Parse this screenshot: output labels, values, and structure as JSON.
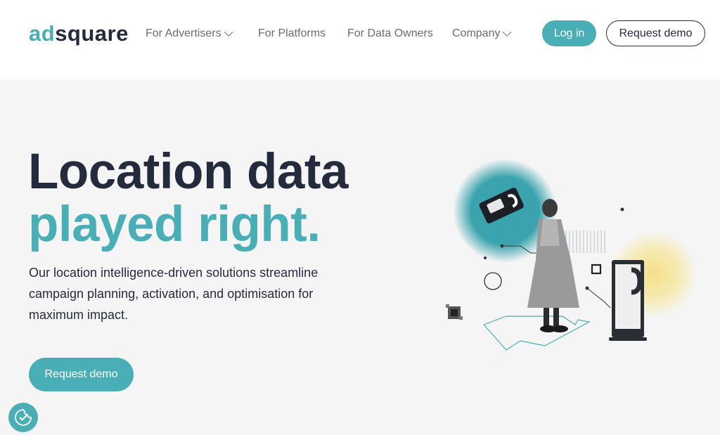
{
  "brand": {
    "logo_part1": "ad",
    "logo_part2": "square",
    "accent": "#4aaeb7",
    "dark": "#242b3d"
  },
  "nav": {
    "items": [
      {
        "label": "For Advertisers",
        "has_dropdown": true
      },
      {
        "label": "For Platforms",
        "has_dropdown": false
      },
      {
        "label": "For Data Owners",
        "has_dropdown": false
      },
      {
        "label": "Company",
        "has_dropdown": true
      }
    ],
    "login_label": "Log in",
    "demo_label": "Request demo"
  },
  "hero": {
    "title_line1": "Location data",
    "title_line2": "played right.",
    "subtitle": "Our location intelligence-driven solutions streamline campaign planning, activation, and optimisation for maximum impact.",
    "cta_label": "Request demo"
  },
  "cookie": {
    "icon": "cookie-consent-icon"
  }
}
